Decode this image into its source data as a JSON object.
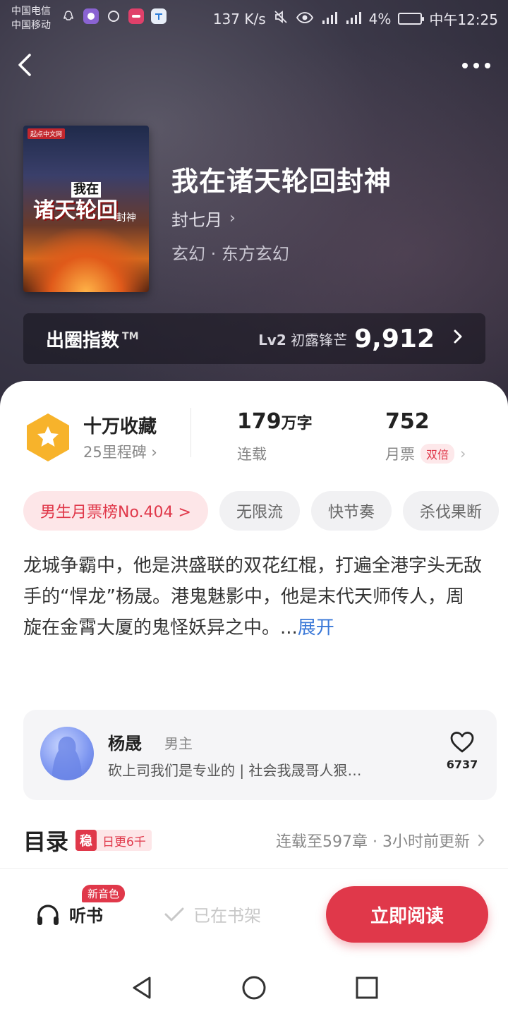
{
  "status_bar": {
    "carrier1": "中国电信",
    "carrier2": "中国移动",
    "speed": "137 K/s",
    "battery": "4%",
    "time": "中午12:25"
  },
  "book": {
    "title": "我在诸天轮回封神",
    "author": "封七月",
    "genre": "玄幻 · 东方玄幻",
    "cover_badge": "起点中文网",
    "cover_title_line1": "我在",
    "cover_title_line2": "诸天轮回",
    "cover_subtitle": "封神"
  },
  "popularity": {
    "title": "出圈指数",
    "tm": "TM",
    "level_code": "Lv2",
    "level_name": "初露锋芒",
    "value": "9,912"
  },
  "stats": {
    "favorites": "十万收藏",
    "milestone": "25里程碑",
    "words_value": "179",
    "words_unit": "万字",
    "words_status": "连载",
    "monthly_tickets": "752",
    "monthly_label": "月票",
    "double_badge": "双倍"
  },
  "tags": [
    "男生月票榜No.404 >",
    "无限流",
    "快节奏",
    "杀伐果断"
  ],
  "synopsis": {
    "text": "龙城争霸中，他是洪盛联的双花红棍，打遍全港字头无敌手的“悍龙”杨晟。港鬼魅影中，他是末代天师传人，周旋在金霄大厦的鬼怪妖异之中。...",
    "expand": "展开"
  },
  "character": {
    "name": "杨晟",
    "role": "男主",
    "desc": "砍上司我们是专业的 | 社会我晟哥人狠…",
    "likes": "6737"
  },
  "toc": {
    "title": "目录",
    "stable_badge": "稳",
    "daily_update": "日更6千",
    "status": "连载至597章 · 3小时前更新"
  },
  "bottom_bar": {
    "listen": "听书",
    "new_voice": "新音色",
    "on_shelf": "已在书架",
    "read_now": "立即阅读"
  },
  "colors": {
    "accent": "#e0384a",
    "link": "#3a78d8",
    "hero_bg": "#3b3848"
  }
}
